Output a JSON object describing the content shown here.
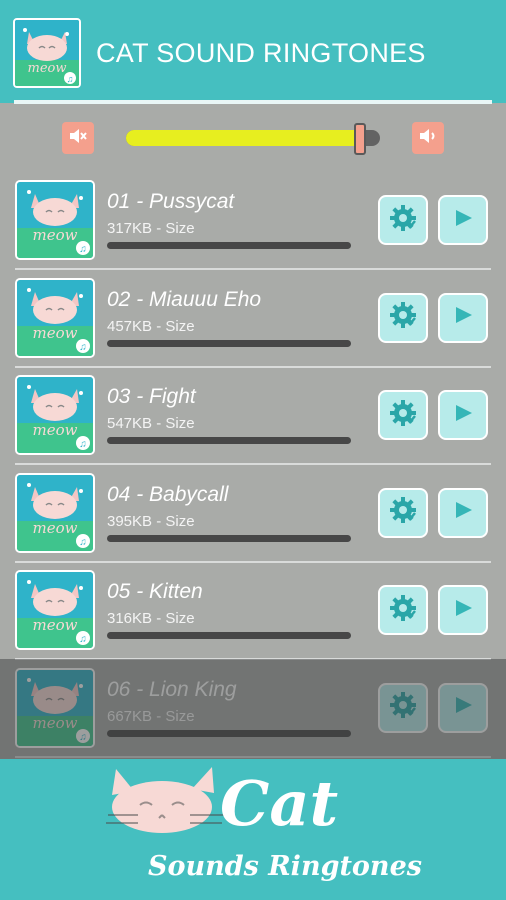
{
  "app": {
    "title": "CAT SOUND RINGTONES",
    "logo_icon": "cat-meow-logo-icon",
    "accent_color": "#45bfc0"
  },
  "volume": {
    "mute_icon": "speaker-mute-icon",
    "max_icon": "speaker-volume-icon",
    "level_percent": 92
  },
  "songs": [
    {
      "title": "01 - Pussycat",
      "size": "317KB - Size",
      "progress_percent": 0
    },
    {
      "title": "02 - Miauuu Eho",
      "size": "457KB - Size",
      "progress_percent": 0
    },
    {
      "title": "03 - Fight",
      "size": "547KB - Size",
      "progress_percent": 0
    },
    {
      "title": "04 - Babycall",
      "size": "395KB - Size",
      "progress_percent": 0
    },
    {
      "title": "05 - Kitten",
      "size": "316KB - Size",
      "progress_percent": 0
    },
    {
      "title": "06 - Lion King",
      "size": "667KB - Size",
      "progress_percent": 0
    }
  ],
  "thumbnail": {
    "logo_text": "meow",
    "icon": "cat-meow-thumbnail-icon"
  },
  "buttons": {
    "settings_icon": "gear-icon",
    "play_icon": "play-icon"
  },
  "banner": {
    "title": "Cat",
    "subtitle": "Sounds Ringtones"
  }
}
